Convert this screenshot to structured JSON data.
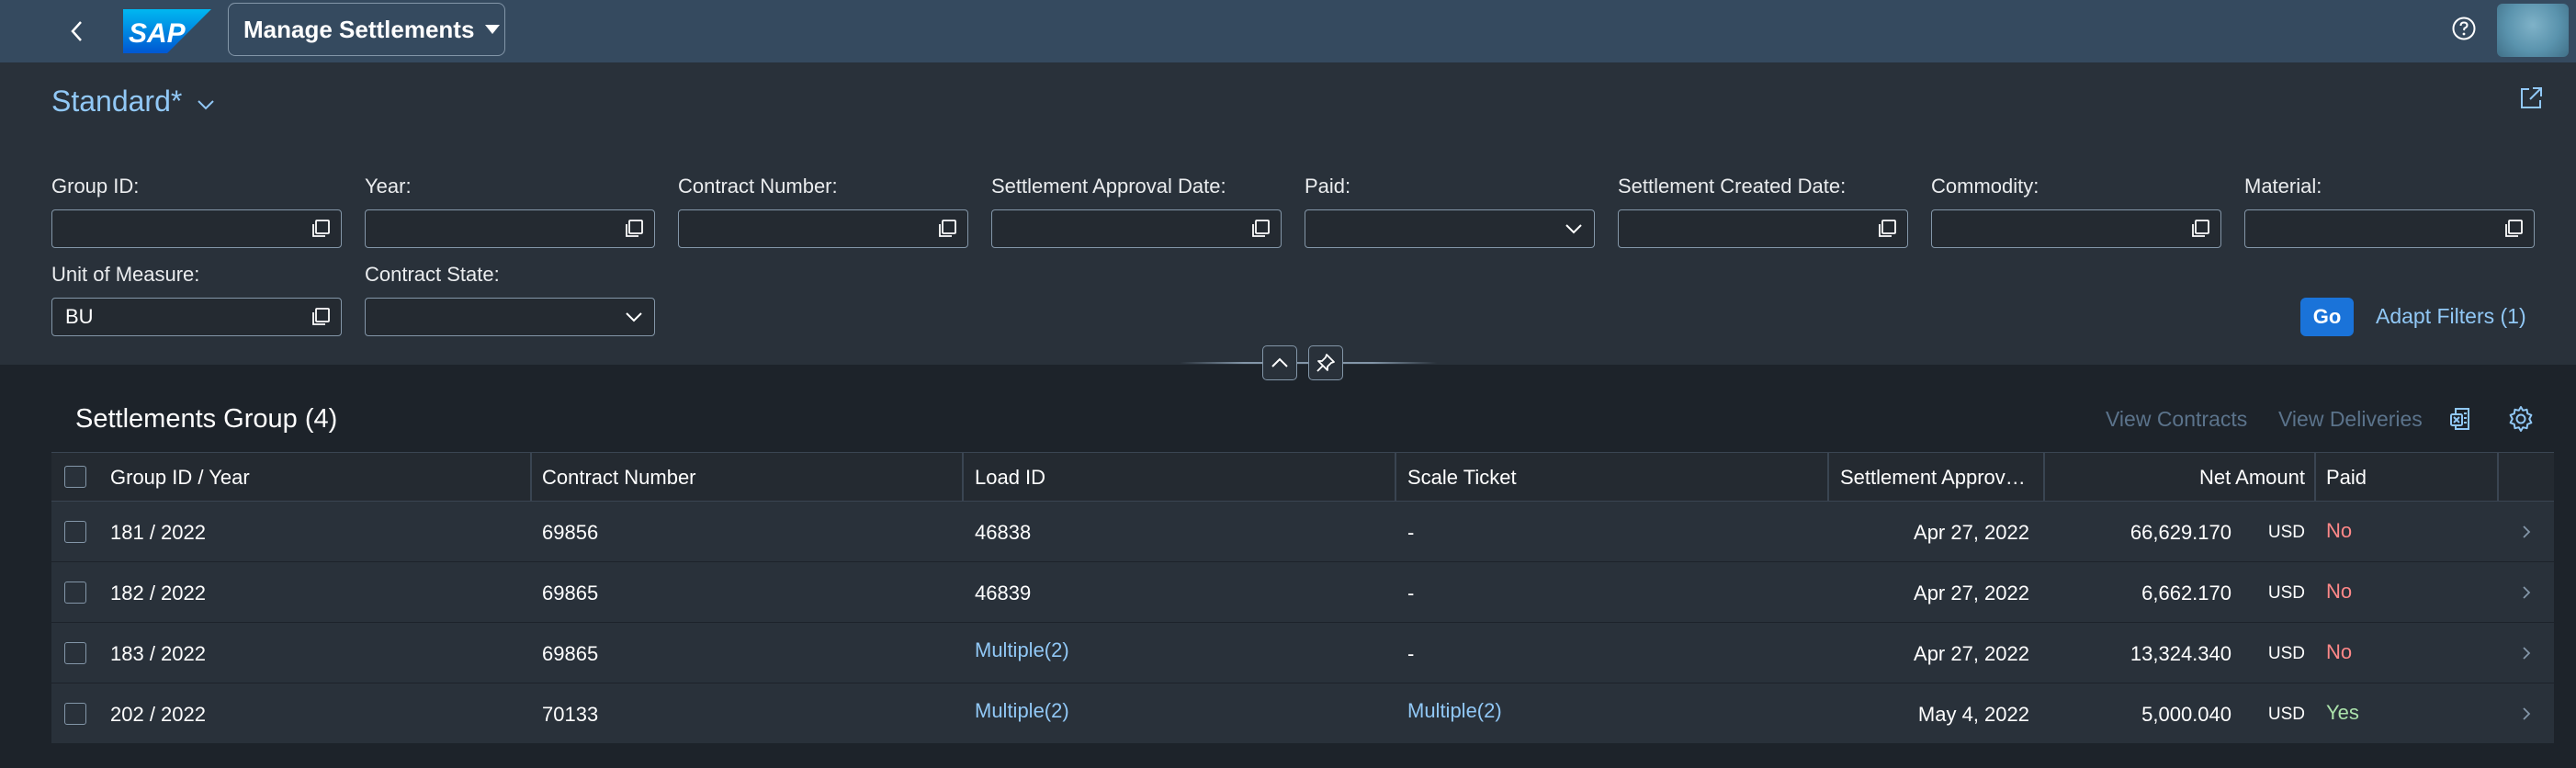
{
  "colors": {
    "shell": "#354a5f",
    "header": "#29313a",
    "accent": "#1a73d9",
    "link": "#91c8f6",
    "negative": "#ff8888",
    "positive": "#abe2ab"
  },
  "shell": {
    "app_title": "Manage Settlements",
    "logo_text": "SAP",
    "icons": {
      "back": "chevron-left-icon",
      "help": "help-icon",
      "avatar": "user-avatar"
    }
  },
  "header": {
    "variant": "Standard*",
    "filters": [
      {
        "label": "Group ID:",
        "value": "",
        "type": "valuehelp"
      },
      {
        "label": "Year:",
        "value": "",
        "type": "valuehelp"
      },
      {
        "label": "Contract Number:",
        "value": "",
        "type": "valuehelp"
      },
      {
        "label": "Settlement Approval Date:",
        "value": "",
        "type": "valuehelp"
      },
      {
        "label": "Paid:",
        "value": "",
        "type": "select"
      },
      {
        "label": "Settlement Created Date:",
        "value": "",
        "type": "valuehelp"
      },
      {
        "label": "Commodity:",
        "value": "",
        "type": "valuehelp"
      },
      {
        "label": "Material:",
        "value": "",
        "type": "valuehelp"
      },
      {
        "label": "Unit of Measure:",
        "value": "BU",
        "type": "valuehelp"
      },
      {
        "label": "Contract State:",
        "value": "",
        "type": "select"
      }
    ],
    "go_label": "Go",
    "adapt_filters_label": "Adapt Filters (1)"
  },
  "table": {
    "title": "Settlements Group (4)",
    "toolbar": {
      "view_contracts": "View Contracts",
      "view_deliveries": "View Deliveries"
    },
    "columns": [
      "Group ID / Year",
      "Contract Number",
      "Load ID",
      "Scale Ticket",
      "Settlement Approv…",
      "Net Amount",
      "Paid"
    ],
    "rows": [
      {
        "group": "181 / 2022",
        "contract": "69856",
        "load": "46838",
        "load_link": false,
        "ticket": "-",
        "ticket_link": false,
        "date": "Apr 27, 2022",
        "amount": "66,629.170",
        "currency": "USD",
        "paid": "No"
      },
      {
        "group": "182 / 2022",
        "contract": "69865",
        "load": "46839",
        "load_link": false,
        "ticket": "-",
        "ticket_link": false,
        "date": "Apr 27, 2022",
        "amount": "6,662.170",
        "currency": "USD",
        "paid": "No"
      },
      {
        "group": "183 / 2022",
        "contract": "69865",
        "load": "Multiple(2)",
        "load_link": true,
        "ticket": "-",
        "ticket_link": false,
        "date": "Apr 27, 2022",
        "amount": "13,324.340",
        "currency": "USD",
        "paid": "No"
      },
      {
        "group": "202 / 2022",
        "contract": "70133",
        "load": "Multiple(2)",
        "load_link": true,
        "ticket": "Multiple(2)",
        "ticket_link": true,
        "date": "May 4, 2022",
        "amount": "5,000.040",
        "currency": "USD",
        "paid": "Yes"
      }
    ]
  }
}
